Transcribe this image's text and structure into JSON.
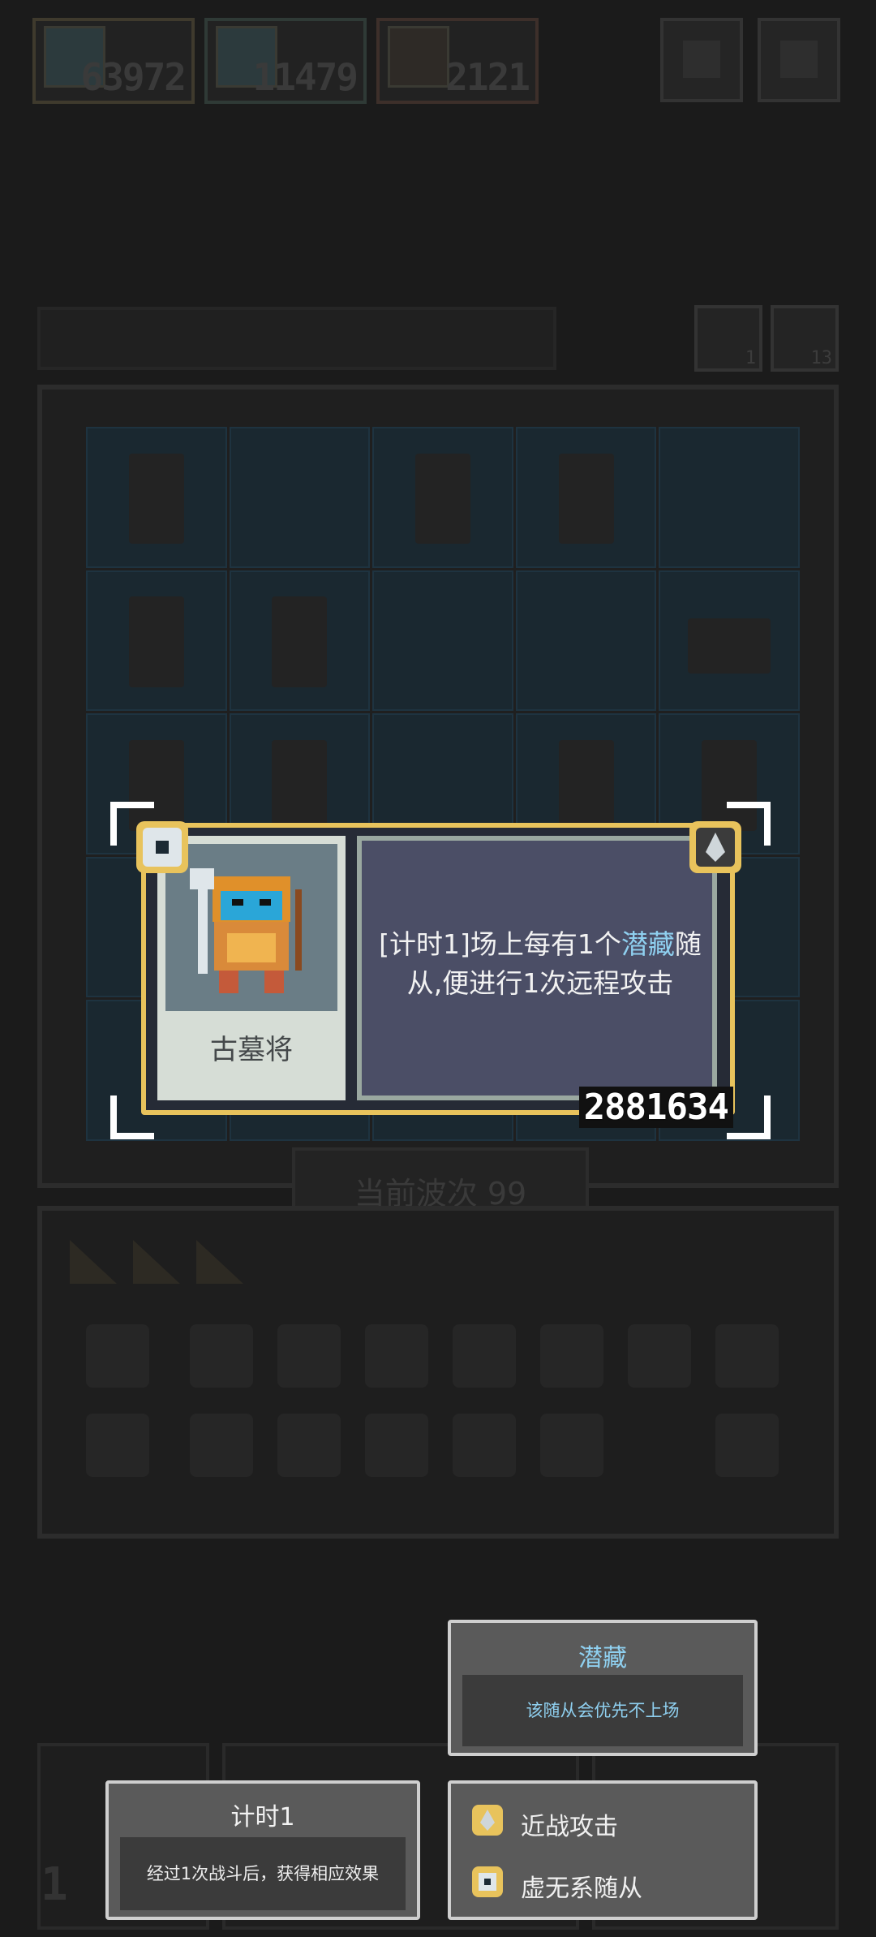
{
  "resources": [
    {
      "icon": "ghost-warrior-icon",
      "value": "63972"
    },
    {
      "icon": "ogre-icon",
      "value": "11479"
    },
    {
      "icon": "hourglass-icon",
      "value": "2121"
    }
  ],
  "top_buttons": [
    "help-icon",
    "settings-icon"
  ],
  "side_buttons": [
    {
      "icon": "exchange-icon",
      "count": "1"
    },
    {
      "icon": "key-icon",
      "count": "13"
    }
  ],
  "wave": {
    "label": "当前波次",
    "value": "99"
  },
  "card": {
    "name": "古墓将",
    "desc_prefix": "[计时1]场上每有1个",
    "desc_keyword": "潜藏",
    "desc_suffix": "随从,便进行1次远程攻击",
    "power": "2881634",
    "badge_left": "void-icon",
    "badge_right": "melee-attack-icon"
  },
  "tooltips": {
    "hide": {
      "title": "潜藏",
      "body": "该随从会优先不上场"
    },
    "timer": {
      "title": "计时1",
      "body": "经过1次战斗后，获得相应效果"
    },
    "traits": [
      {
        "icon": "melee-attack-icon",
        "label": "近战攻击"
      },
      {
        "icon": "void-icon",
        "label": "虚无系随从"
      }
    ]
  },
  "bottom": {
    "level": "1"
  },
  "colors": {
    "accent": "#e8c35c",
    "keyword": "#8fd0f0",
    "card_bg": "#4b4e66"
  }
}
